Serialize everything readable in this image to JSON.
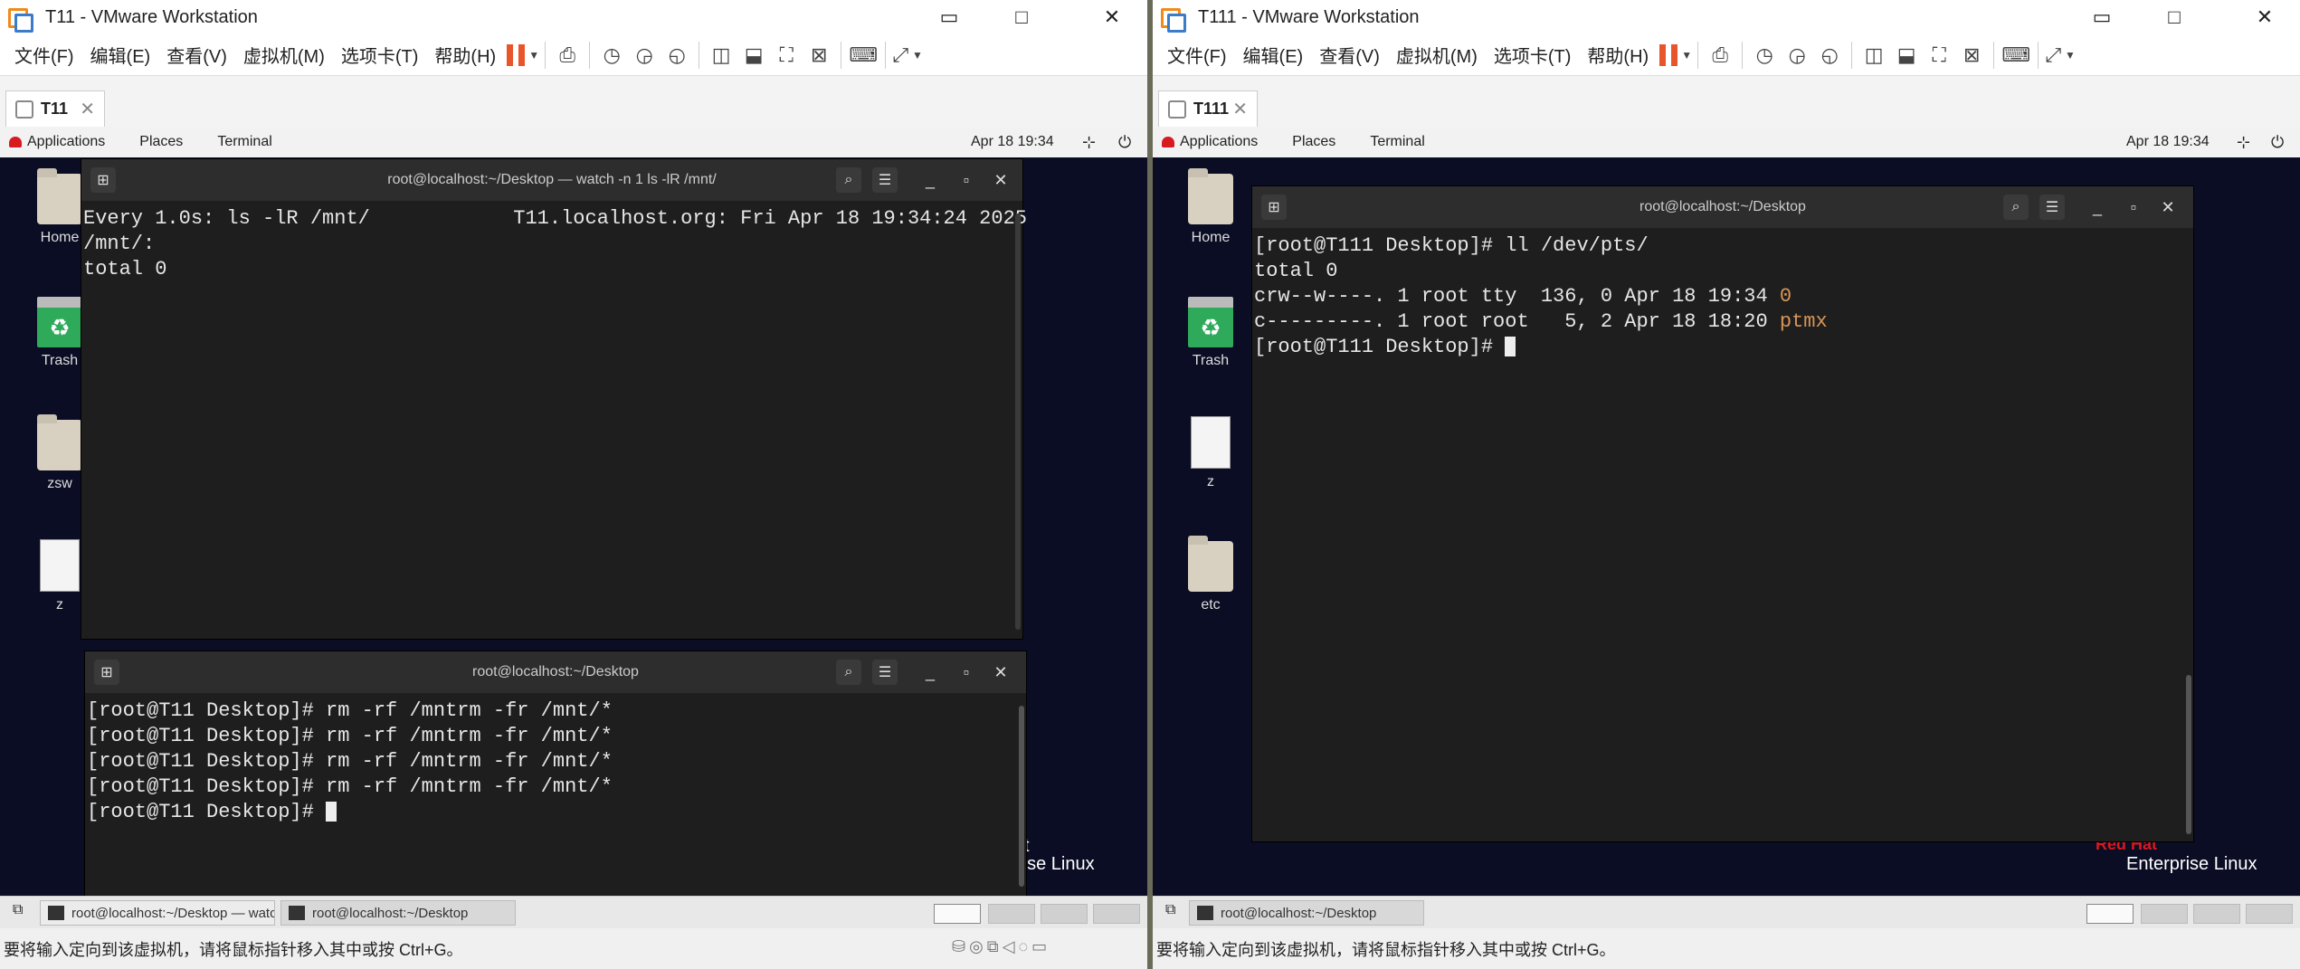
{
  "window_left": {
    "title": "T11 - VMware Workstation",
    "tab_label": "T11",
    "terminal_top": {
      "title": "root@localhost:~/Desktop — watch -n 1 ls -lR /mnt/",
      "lines": [
        "Every 1.0s: ls -lR /mnt/            T11.localhost.org: Fri Apr 18 19:34:24 2025",
        "",
        "/mnt/:",
        "total 0"
      ]
    },
    "terminal_bottom": {
      "title": "root@localhost:~/Desktop",
      "lines": [
        "[root@T11 Desktop]# rm -rf /mntrm -fr /mnt/*",
        "[root@T11 Desktop]# rm -rf /mntrm -fr /mnt/*",
        "[root@T11 Desktop]# rm -rf /mntrm -fr /mnt/*",
        "[root@T11 Desktop]# rm -rf /mntrm -fr /mnt/*"
      ],
      "prompt": "[root@T11 Desktop]# "
    },
    "desktop_icons": [
      "Home",
      "Trash",
      "zsw",
      "z"
    ],
    "redhat_partial": [
      "t",
      "rise Linux"
    ],
    "taskbar_items": [
      "root@localhost:~/Desktop — watc...",
      "root@localhost:~/Desktop"
    ]
  },
  "window_right": {
    "title": "T111 - VMware Workstation",
    "tab_label": "T111",
    "terminal": {
      "title": "root@localhost:~/Desktop",
      "lines": [
        {
          "text": "[root@T111 Desktop]# ll /dev/pts/",
          "hl": ""
        },
        {
          "text": "total 0",
          "hl": ""
        },
        {
          "text": "crw--w----. 1 root tty  136, 0 Apr 18 19:34 ",
          "hl": "0"
        },
        {
          "text": "c---------. 1 root root   5, 2 Apr 18 18:20 ",
          "hl": "ptmx"
        }
      ],
      "prompt": "[root@T111 Desktop]# "
    },
    "desktop_icons": [
      "Home",
      "Trash",
      "z",
      "etc"
    ],
    "redhat": [
      "Red Hat",
      "Enterprise Linux"
    ],
    "taskbar_items": [
      "root@localhost:~/Desktop"
    ]
  },
  "menu": [
    "文件(F)",
    "编辑(E)",
    "查看(V)",
    "虚拟机(M)",
    "选项卡(T)",
    "帮助(H)"
  ],
  "gnome": {
    "applications": "Applications",
    "places": "Places",
    "terminal": "Terminal",
    "clock": "Apr 18  19:34"
  },
  "status_text": "要将输入定向到该虚拟机，请将鼠标指针移入其中或按 Ctrl+G。",
  "colors": {
    "highlight": "#d89556",
    "pause": "#e8552a"
  }
}
